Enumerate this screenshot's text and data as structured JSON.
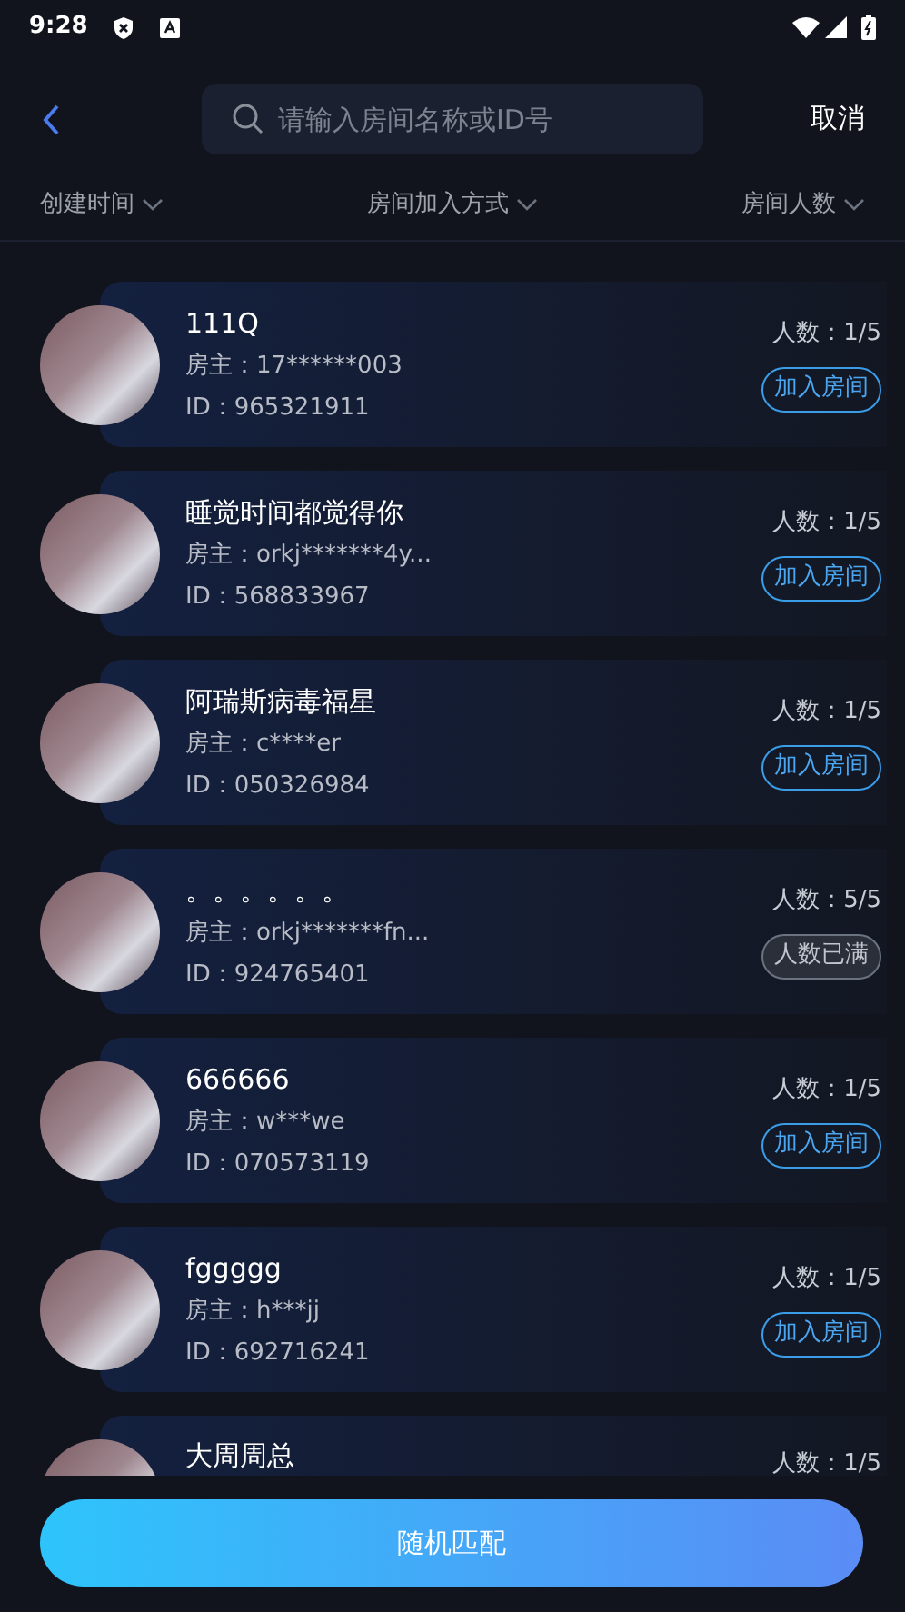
{
  "status_bar": {
    "time": "9:28"
  },
  "header": {
    "search": {
      "placeholder": "请输入房间名称或ID号"
    },
    "cancel": "取消"
  },
  "filters": [
    {
      "label": "创建时间"
    },
    {
      "label": "房间加入方式"
    },
    {
      "label": "房间人数"
    }
  ],
  "rooms": [
    {
      "name": "111Q",
      "owner": "房主：17******003",
      "id": "ID：965321911",
      "count": "人数：1/5",
      "kind": "join",
      "action": "加入房间"
    },
    {
      "name": "睡觉时间都觉得你",
      "owner": "房主：orkj*******4y...",
      "id": "ID：568833967",
      "count": "人数：1/5",
      "kind": "join",
      "action": "加入房间"
    },
    {
      "name": "阿瑞斯病毒福星",
      "owner": "房主：c****er",
      "id": "ID：050326984",
      "count": "人数：1/5",
      "kind": "join",
      "action": "加入房间"
    },
    {
      "name": "。。。。。。",
      "owner": "房主：orkj*******fn...",
      "id": "ID：924765401",
      "count": "人数：5/5",
      "kind": "full",
      "action": "人数已满"
    },
    {
      "name": "666666",
      "owner": "房主：w***we",
      "id": "ID：070573119",
      "count": "人数：1/5",
      "kind": "join",
      "action": "加入房间"
    },
    {
      "name": "fggggg",
      "owner": "房主：h***jj",
      "id": "ID：692716241",
      "count": "人数：1/5",
      "kind": "join",
      "action": "加入房间"
    },
    {
      "name": "大周周总",
      "count": "人数：1/5",
      "kind": "partial"
    }
  ],
  "random_match_button": "随机匹配"
}
